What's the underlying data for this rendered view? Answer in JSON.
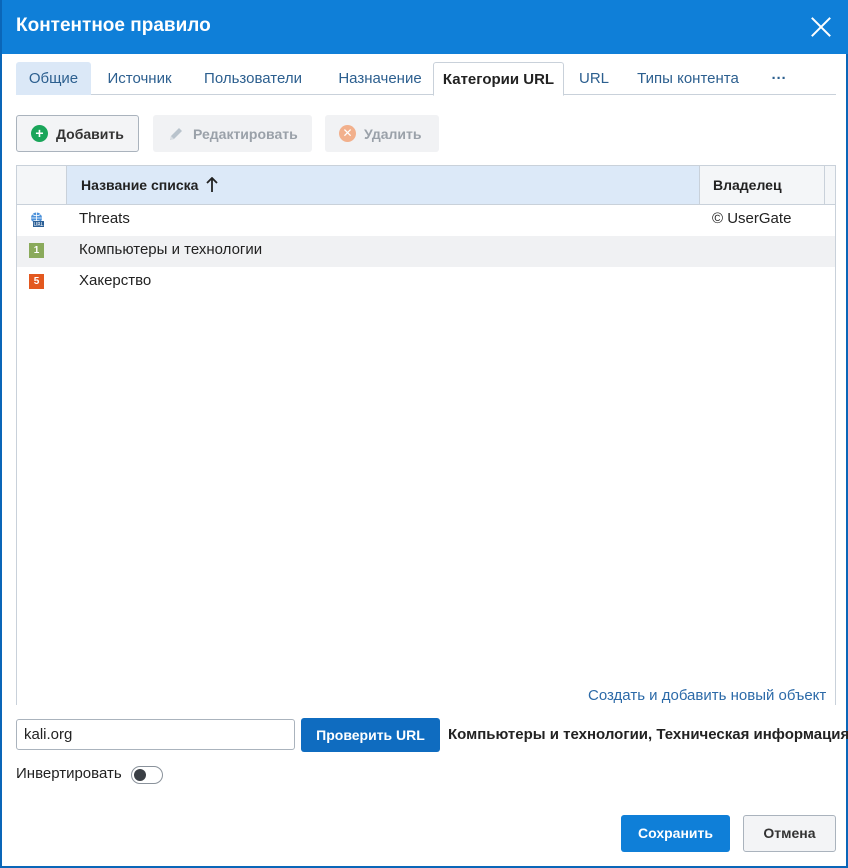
{
  "dialog": {
    "title": "Контентное правило"
  },
  "tabs": [
    {
      "label": "Общие"
    },
    {
      "label": "Источник"
    },
    {
      "label": "Пользователи"
    },
    {
      "label": "Назначение"
    },
    {
      "label": "Категории URL"
    },
    {
      "label": "URL"
    },
    {
      "label": "Типы контента"
    },
    {
      "label": "···"
    }
  ],
  "active_tab": "Категории URL",
  "toolbar": {
    "add_label": "Добавить",
    "edit_label": "Редактировать",
    "delete_label": "Удалить"
  },
  "grid": {
    "columns": {
      "name": "Название списка",
      "owner": "Владелец"
    },
    "sort": "ascending",
    "rows": [
      {
        "icon": "globe-url-icon",
        "badge": "",
        "name": "Threats",
        "owner": "© UserGate"
      },
      {
        "icon": "number-badge-icon",
        "badge": "1",
        "badge_color": "#8aaa5b",
        "name": "Компьютеры и технологии",
        "owner": ""
      },
      {
        "icon": "number-badge-icon",
        "badge": "5",
        "badge_color": "#e3581f",
        "name": "Хакерство",
        "owner": ""
      }
    ]
  },
  "create_link": "Создать и добавить новый объект",
  "url_check": {
    "value": "kali.org",
    "button_label": "Проверить URL",
    "result": "Компьютеры и технологии, Техническая информация"
  },
  "invert": {
    "label": "Инвертировать",
    "enabled": false
  },
  "footer": {
    "save_label": "Сохранить",
    "cancel_label": "Отмена"
  },
  "colors": {
    "titlebar": "#0f7fd8",
    "primary_button": "#0f6cc0",
    "add_icon": "#1aa55a",
    "link": "#2c6aa8"
  }
}
